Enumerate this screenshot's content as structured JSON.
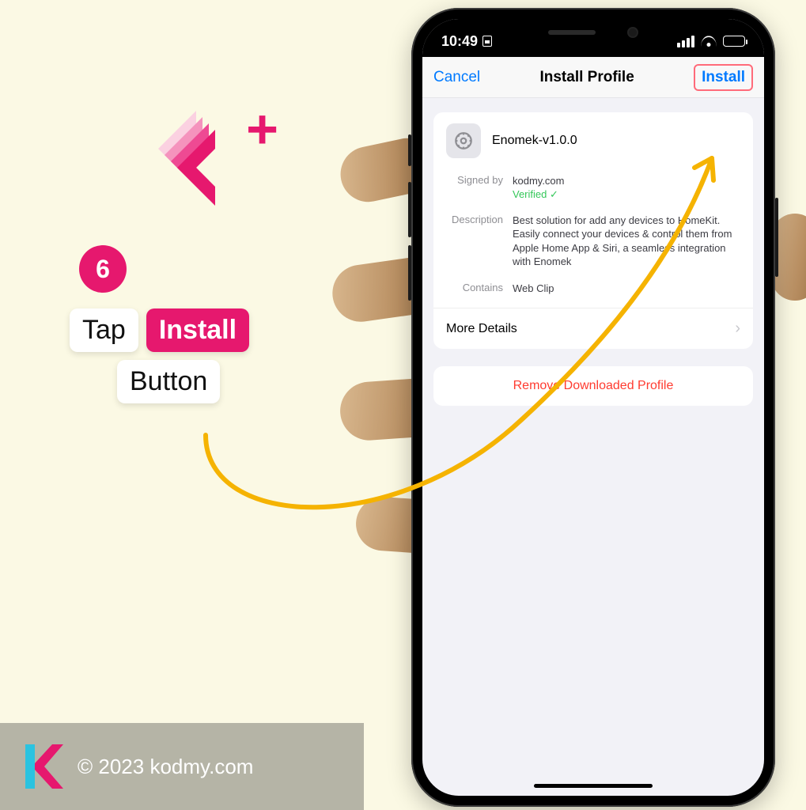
{
  "logo": {
    "plus": "+"
  },
  "step": {
    "number": "6",
    "word_tap": "Tap",
    "word_install": "Install",
    "word_button": "Button"
  },
  "footer": {
    "copyright": "© 2023 kodmy.com"
  },
  "phone": {
    "statusbar": {
      "time": "10:49"
    },
    "nav": {
      "cancel": "Cancel",
      "title": "Install Profile",
      "install": "Install"
    },
    "profile": {
      "name": "Enomek-v1.0.0",
      "signed_by_label": "Signed by",
      "signed_by_value": "kodmy.com",
      "verified": "Verified",
      "desc_label": "Description",
      "desc_value": "Best solution for add any devices to HomeKit. Easily connect your devices & control them from Apple Home App & Siri, a seamless integration with Enomek",
      "contains_label": "Contains",
      "contains_value": "Web Clip",
      "more": "More Details"
    },
    "remove": "Remove Downloaded Profile"
  }
}
